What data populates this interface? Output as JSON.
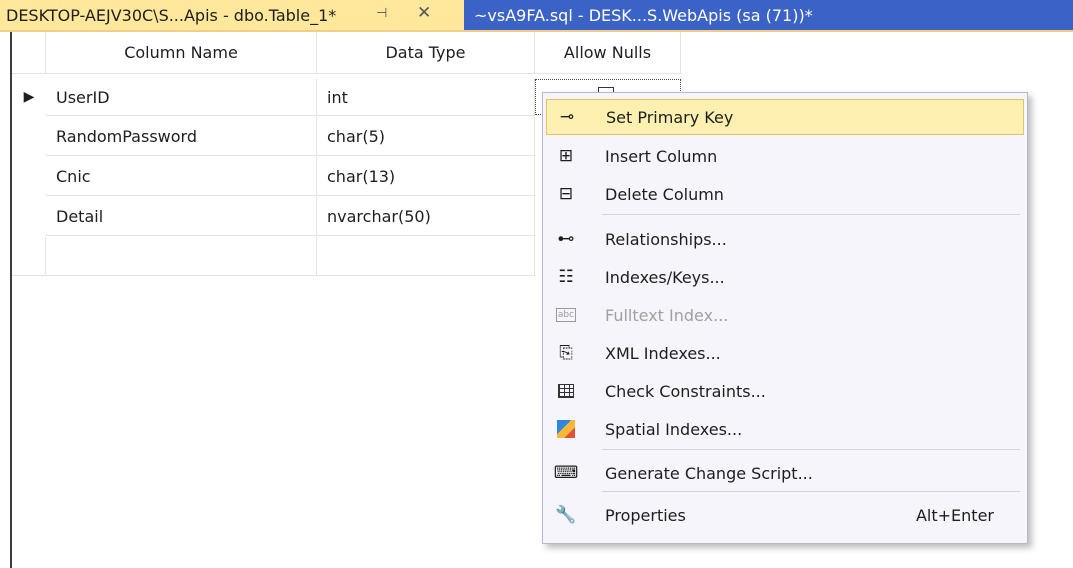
{
  "tabs": {
    "active": {
      "title": "DESKTOP-AEJV30C\\S...Apis - dbo.Table_1*"
    },
    "inactive": {
      "title": "~vsA9FA.sql - DESK...S.WebApis (sa (71))*"
    }
  },
  "table": {
    "headers": [
      "Column Name",
      "Data Type",
      "Allow Nulls"
    ],
    "rows": [
      {
        "name": "UserID",
        "type": "int"
      },
      {
        "name": "RandomPassword",
        "type": "char(5)"
      },
      {
        "name": "Cnic",
        "type": "char(13)"
      },
      {
        "name": "Detail",
        "type": "nvarchar(50)"
      }
    ],
    "current_row_marker": "▶"
  },
  "context_menu": {
    "items": [
      {
        "label": "Set Primary Key",
        "icon": "key-icon"
      },
      {
        "label": "Insert Column",
        "icon": "insert-column-icon"
      },
      {
        "label": "Delete Column",
        "icon": "delete-column-icon"
      },
      {
        "label": "Relationships...",
        "icon": "relationships-icon"
      },
      {
        "label": "Indexes/Keys...",
        "icon": "indexes-icon"
      },
      {
        "label": "Fulltext Index...",
        "icon": "fulltext-icon",
        "disabled": true
      },
      {
        "label": "XML Indexes...",
        "icon": "xml-index-icon"
      },
      {
        "label": "Check Constraints...",
        "icon": "check-constraints-icon"
      },
      {
        "label": "Spatial Indexes...",
        "icon": "spatial-index-icon"
      },
      {
        "label": "Generate Change Script...",
        "icon": "change-script-icon"
      },
      {
        "label": "Properties",
        "icon": "wrench-icon",
        "shortcut": "Alt+Enter"
      }
    ],
    "fulltext_icon_text": "abc"
  },
  "colors": {
    "active_tab": "#ffe79b",
    "inactive_tab": "#3b62c6",
    "menu_highlight": "#fdf0b0"
  }
}
